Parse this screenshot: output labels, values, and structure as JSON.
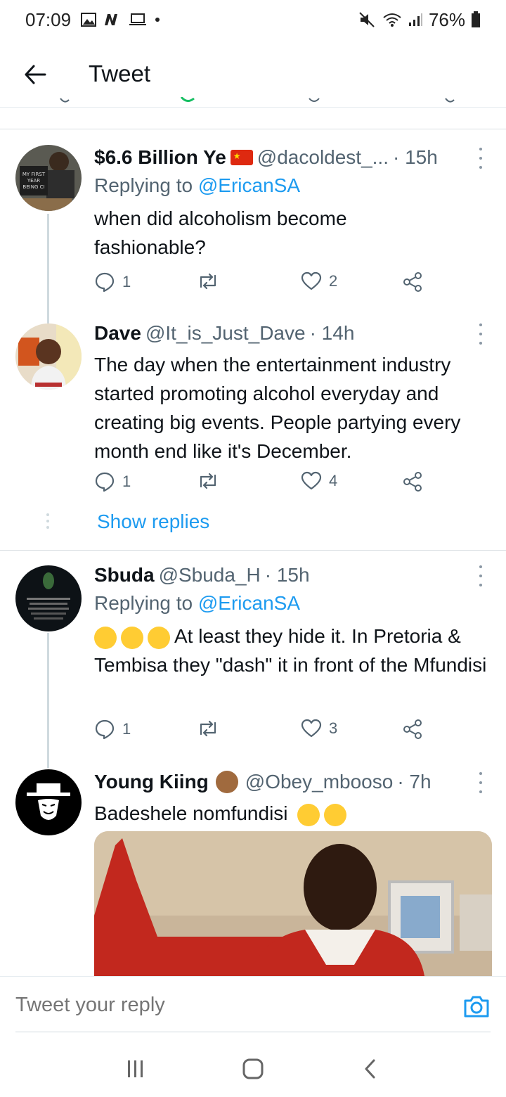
{
  "status_bar": {
    "time": "07:09",
    "battery": "76%"
  },
  "header": {
    "title": "Tweet"
  },
  "tweets": [
    {
      "name": "$6.6 Billion Ye",
      "handle": "@dacoldest_...",
      "time": "· 15h",
      "replying_label": "Replying to",
      "replying_to": "@EricanSA",
      "text": "when did alcoholism become fashionable?",
      "replies": "1",
      "likes": "2",
      "avatar_text": "MY FIRST YEAR BEING CI"
    },
    {
      "name": "Dave",
      "handle": "@It_is_Just_Dave",
      "time": "· 14h",
      "text": "The day when the entertainment industry started promoting alcohol everyday and creating big events. People partying every month end like it's December.",
      "replies": "1",
      "likes": "4",
      "show_replies": "Show replies"
    },
    {
      "name": "Sbuda",
      "handle": "@Sbuda_H",
      "time": "· 15h",
      "replying_label": "Replying to",
      "replying_to": "@EricanSA",
      "text": "At least they hide it. In Pretoria & Tembisa they \"dash\" it in front of the Mfundisi",
      "replies": "1",
      "likes": "3"
    },
    {
      "name": "Young Kiing",
      "handle": "@Obey_mbooso",
      "time": "· 7h",
      "text": "Badeshele nomfundisi"
    }
  ],
  "reply_bar": {
    "placeholder": "Tweet your reply"
  },
  "icons": {
    "back": "arrow-left-icon",
    "reply": "reply-icon",
    "retweet": "retweet-icon",
    "like": "heart-icon",
    "share": "share-icon",
    "camera": "camera-icon"
  },
  "colors": {
    "link": "#1d9bf0",
    "secondary": "#536471",
    "text": "#0f1419"
  }
}
